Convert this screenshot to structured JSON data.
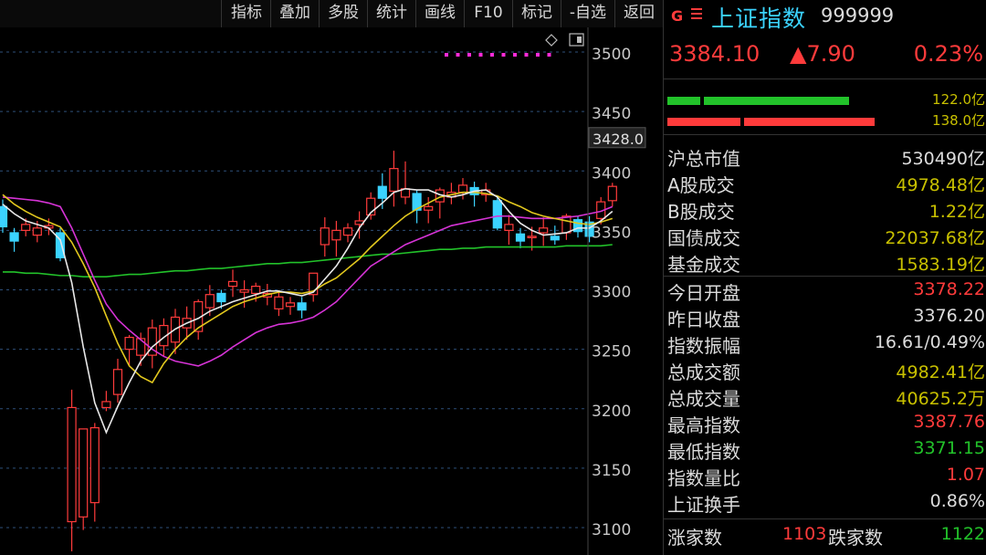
{
  "toolbar": {
    "buttons": [
      "指标",
      "叠加",
      "多股",
      "统计",
      "画线",
      "F10",
      "标记",
      "-自选",
      "返回"
    ]
  },
  "colors": {
    "up": "#ff3b3b",
    "down": "#3bd3ff",
    "ma_fast": "#e8e8e8",
    "ma_mid": "#e2c81e",
    "ma_slow": "#d633d6",
    "ma_long": "#22c22a",
    "green": "#22c22a",
    "red": "#ff3b3b",
    "yellow": "#c8c000"
  },
  "header": {
    "icon": "G",
    "name": "上证指数",
    "code": "999999",
    "price": "3384.10",
    "change": "▲7.90",
    "change_pct": "0.23%"
  },
  "buy_sell": {
    "green_label": "122.0亿",
    "red_label": "138.0亿"
  },
  "stats": [
    {
      "label": "沪总市值",
      "value": "530490亿",
      "color": "white"
    },
    {
      "label": "A股成交",
      "value": "4978.48亿",
      "color": "yellow"
    },
    {
      "label": "B股成交",
      "value": "1.22亿",
      "color": "yellow"
    },
    {
      "label": "国债成交",
      "value": "22037.68亿",
      "color": "yellow"
    },
    {
      "label": "基金成交",
      "value": "1583.19亿",
      "color": "yellow"
    },
    {
      "label": "今日开盘",
      "value": "3378.22",
      "color": "red"
    },
    {
      "label": "昨日收盘",
      "value": "3376.20",
      "color": "white"
    },
    {
      "label": "指数振幅",
      "value": "16.61/0.49%",
      "color": "white"
    },
    {
      "label": "总成交额",
      "value": "4982.41亿",
      "color": "yellow"
    },
    {
      "label": "总成交量",
      "value": "40625.2万",
      "color": "yellow"
    },
    {
      "label": "最高指数",
      "value": "3387.76",
      "color": "red"
    },
    {
      "label": "最低指数",
      "value": "3371.15",
      "color": "green"
    },
    {
      "label": "指数量比",
      "value": "1.07",
      "color": "red"
    },
    {
      "label": "上证换手",
      "value": "0.86%",
      "color": "white"
    }
  ],
  "breadth": {
    "up_label": "涨家数",
    "up_value": "1103",
    "down_label": "跌家数",
    "down_value": "1122"
  },
  "chart_data": {
    "type": "candlestick",
    "title": "",
    "xlabel": "",
    "ylabel": "",
    "ylim": [
      3085,
      3520
    ],
    "y_ticks": [
      3500,
      3450,
      3400,
      3350,
      3300,
      3250,
      3200,
      3150,
      3100
    ],
    "cursor_label": "3428.0",
    "candles": [
      {
        "o": 3370,
        "h": 3376,
        "l": 3348,
        "c": 3353
      },
      {
        "o": 3348,
        "h": 3352,
        "l": 3332,
        "c": 3341
      },
      {
        "o": 3350,
        "h": 3360,
        "l": 3345,
        "c": 3355
      },
      {
        "o": 3346,
        "h": 3358,
        "l": 3340,
        "c": 3352
      },
      {
        "o": 3352,
        "h": 3360,
        "l": 3346,
        "c": 3354
      },
      {
        "o": 3348,
        "h": 3352,
        "l": 3324,
        "c": 3327
      },
      {
        "o": 3105,
        "h": 3216,
        "l": 3080,
        "c": 3201
      },
      {
        "o": 3109,
        "h": 3168,
        "l": 3098,
        "c": 3183
      },
      {
        "o": 3121,
        "h": 3188,
        "l": 3105,
        "c": 3184
      },
      {
        "o": 3201,
        "h": 3215,
        "l": 3198,
        "c": 3206
      },
      {
        "o": 3212,
        "h": 3242,
        "l": 3205,
        "c": 3233
      },
      {
        "o": 3250,
        "h": 3262,
        "l": 3236,
        "c": 3260
      },
      {
        "o": 3245,
        "h": 3264,
        "l": 3236,
        "c": 3259
      },
      {
        "o": 3245,
        "h": 3275,
        "l": 3234,
        "c": 3268
      },
      {
        "o": 3253,
        "h": 3276,
        "l": 3244,
        "c": 3270
      },
      {
        "o": 3256,
        "h": 3284,
        "l": 3246,
        "c": 3277
      },
      {
        "o": 3268,
        "h": 3286,
        "l": 3258,
        "c": 3276
      },
      {
        "o": 3265,
        "h": 3292,
        "l": 3258,
        "c": 3290
      },
      {
        "o": 3285,
        "h": 3304,
        "l": 3278,
        "c": 3296
      },
      {
        "o": 3297,
        "h": 3300,
        "l": 3284,
        "c": 3290
      },
      {
        "o": 3303,
        "h": 3317,
        "l": 3294,
        "c": 3307
      },
      {
        "o": 3298,
        "h": 3308,
        "l": 3285,
        "c": 3300
      },
      {
        "o": 3297,
        "h": 3306,
        "l": 3290,
        "c": 3303
      },
      {
        "o": 3294,
        "h": 3305,
        "l": 3287,
        "c": 3297
      },
      {
        "o": 3284,
        "h": 3298,
        "l": 3278,
        "c": 3294
      },
      {
        "o": 3286,
        "h": 3294,
        "l": 3279,
        "c": 3289
      },
      {
        "o": 3289,
        "h": 3294,
        "l": 3276,
        "c": 3283
      },
      {
        "o": 3296,
        "h": 3312,
        "l": 3290,
        "c": 3314
      },
      {
        "o": 3338,
        "h": 3361,
        "l": 3328,
        "c": 3352
      },
      {
        "o": 3342,
        "h": 3358,
        "l": 3328,
        "c": 3350
      },
      {
        "o": 3346,
        "h": 3356,
        "l": 3340,
        "c": 3352
      },
      {
        "o": 3355,
        "h": 3366,
        "l": 3343,
        "c": 3358
      },
      {
        "o": 3363,
        "h": 3382,
        "l": 3359,
        "c": 3377
      },
      {
        "o": 3387,
        "h": 3398,
        "l": 3368,
        "c": 3377
      },
      {
        "o": 3383,
        "h": 3417,
        "l": 3370,
        "c": 3402
      },
      {
        "o": 3378,
        "h": 3408,
        "l": 3372,
        "c": 3385
      },
      {
        "o": 3381,
        "h": 3384,
        "l": 3356,
        "c": 3367
      },
      {
        "o": 3367,
        "h": 3378,
        "l": 3356,
        "c": 3370
      },
      {
        "o": 3374,
        "h": 3386,
        "l": 3360,
        "c": 3384
      },
      {
        "o": 3378,
        "h": 3390,
        "l": 3372,
        "c": 3382
      },
      {
        "o": 3382,
        "h": 3394,
        "l": 3376,
        "c": 3388
      },
      {
        "o": 3386,
        "h": 3391,
        "l": 3370,
        "c": 3380
      },
      {
        "o": 3380,
        "h": 3390,
        "l": 3374,
        "c": 3384
      },
      {
        "o": 3375,
        "h": 3378,
        "l": 3350,
        "c": 3352
      },
      {
        "o": 3350,
        "h": 3363,
        "l": 3338,
        "c": 3355
      },
      {
        "o": 3347,
        "h": 3352,
        "l": 3335,
        "c": 3341
      },
      {
        "o": 3344,
        "h": 3353,
        "l": 3333,
        "c": 3345
      },
      {
        "o": 3348,
        "h": 3361,
        "l": 3337,
        "c": 3352
      },
      {
        "o": 3345,
        "h": 3354,
        "l": 3338,
        "c": 3342
      },
      {
        "o": 3348,
        "h": 3364,
        "l": 3342,
        "c": 3362
      },
      {
        "o": 3359,
        "h": 3362,
        "l": 3344,
        "c": 3349
      },
      {
        "o": 3357,
        "h": 3362,
        "l": 3340,
        "c": 3345
      },
      {
        "o": 3360,
        "h": 3378,
        "l": 3355,
        "c": 3374
      },
      {
        "o": 3375,
        "h": 3390,
        "l": 3370,
        "c": 3387
      }
    ],
    "ma_lines": {
      "ma5": [
        3372,
        3364,
        3358,
        3355,
        3352,
        3342,
        3306,
        3252,
        3205,
        3180,
        3202,
        3222,
        3240,
        3252,
        3260,
        3267,
        3272,
        3276,
        3282,
        3286,
        3290,
        3293,
        3296,
        3299,
        3299,
        3297,
        3295,
        3298,
        3309,
        3320,
        3335,
        3352,
        3365,
        3373,
        3382,
        3385,
        3384,
        3384,
        3380,
        3378,
        3380,
        3383,
        3384,
        3378,
        3366,
        3356,
        3350,
        3346,
        3347,
        3348,
        3352,
        3352,
        3358,
        3366
      ],
      "ma10": [
        3380,
        3372,
        3366,
        3361,
        3357,
        3353,
        3340,
        3322,
        3302,
        3278,
        3255,
        3236,
        3227,
        3222,
        3238,
        3250,
        3260,
        3268,
        3274,
        3280,
        3286,
        3290,
        3293,
        3296,
        3298,
        3298,
        3297,
        3299,
        3305,
        3310,
        3318,
        3326,
        3336,
        3345,
        3354,
        3362,
        3368,
        3373,
        3378,
        3380,
        3382,
        3382,
        3381,
        3379,
        3374,
        3370,
        3365,
        3362,
        3360,
        3358,
        3356,
        3355,
        3357,
        3360
      ],
      "ma20": [
        3378,
        3377,
        3376,
        3375,
        3373,
        3370,
        3352,
        3330,
        3308,
        3288,
        3275,
        3266,
        3258,
        3250,
        3244,
        3240,
        3238,
        3236,
        3240,
        3245,
        3252,
        3258,
        3264,
        3268,
        3271,
        3272,
        3274,
        3277,
        3283,
        3290,
        3300,
        3310,
        3320,
        3326,
        3332,
        3338,
        3342,
        3346,
        3350,
        3354,
        3356,
        3358,
        3360,
        3362,
        3362,
        3361,
        3360,
        3360,
        3360,
        3361,
        3362,
        3364,
        3366,
        3370
      ],
      "ma60": [
        3315,
        3315,
        3314,
        3314,
        3313,
        3312,
        3312,
        3311,
        3311,
        3311,
        3312,
        3313,
        3313,
        3314,
        3315,
        3316,
        3316,
        3317,
        3318,
        3318,
        3319,
        3320,
        3321,
        3322,
        3322,
        3323,
        3323,
        3324,
        3325,
        3326,
        3327,
        3328,
        3329,
        3330,
        3330,
        3331,
        3332,
        3333,
        3334,
        3334,
        3335,
        3335,
        3336,
        3336,
        3336,
        3336,
        3336,
        3336,
        3336,
        3337,
        3337,
        3337,
        3337,
        3338
      ]
    }
  }
}
